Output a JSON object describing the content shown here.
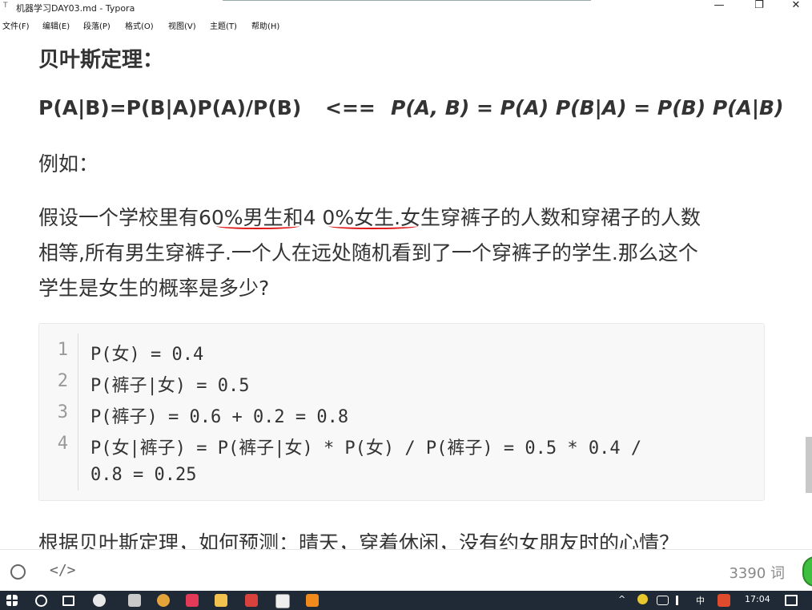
{
  "window": {
    "title": "机器学习DAY03.md - Typora",
    "icon": "T",
    "controls": {
      "minimize": "—",
      "restore": "❐",
      "close": "✕"
    }
  },
  "menu": [
    "文件(F)",
    "编辑(E)",
    "段落(P)",
    "格式(O)",
    "视图(V)",
    "主题(T)",
    "帮助(H)"
  ],
  "document": {
    "heading": "贝叶斯定理：",
    "formula_left": "P(A|B)=P(B|A)P(A)/P(B)",
    "formula_arrow": "<==",
    "formula_right": "P(A, B) = P(A) P(B|A) = P(B) P(A|B)",
    "example_label": "例如：",
    "question_line1": "假设一个学校里有60%男生和4 0%女生.女生穿裤子的人数和穿裙子的人数",
    "question_line2": "相等,所有男生穿裤子.一个人在远处随机看到了一个穿裤子的学生.那么这个",
    "question_line3": "学生是女生的概率是多少?",
    "code_lines": [
      {
        "num": "1",
        "text": "P(女) = 0.4"
      },
      {
        "num": "2",
        "text": "P(裤子|女) = 0.5"
      },
      {
        "num": "3",
        "text": "P(裤子) = 0.6 + 0.2 = 0.8"
      },
      {
        "num": "4",
        "text": "P(女|裤子) = P(裤子|女) * P(女) / P(裤子) = 0.5 * 0.4 /"
      },
      {
        "num": "",
        "text": "0.8 = 0.25"
      }
    ],
    "next_line": "根据贝叶斯定理，如何预测：晴天，穿着休闲，没有约女朋友时的心情？"
  },
  "status": {
    "source_icon": "</>",
    "word_count": "3390 词"
  },
  "taskbar": {
    "ime": "中",
    "time": "17:04"
  }
}
